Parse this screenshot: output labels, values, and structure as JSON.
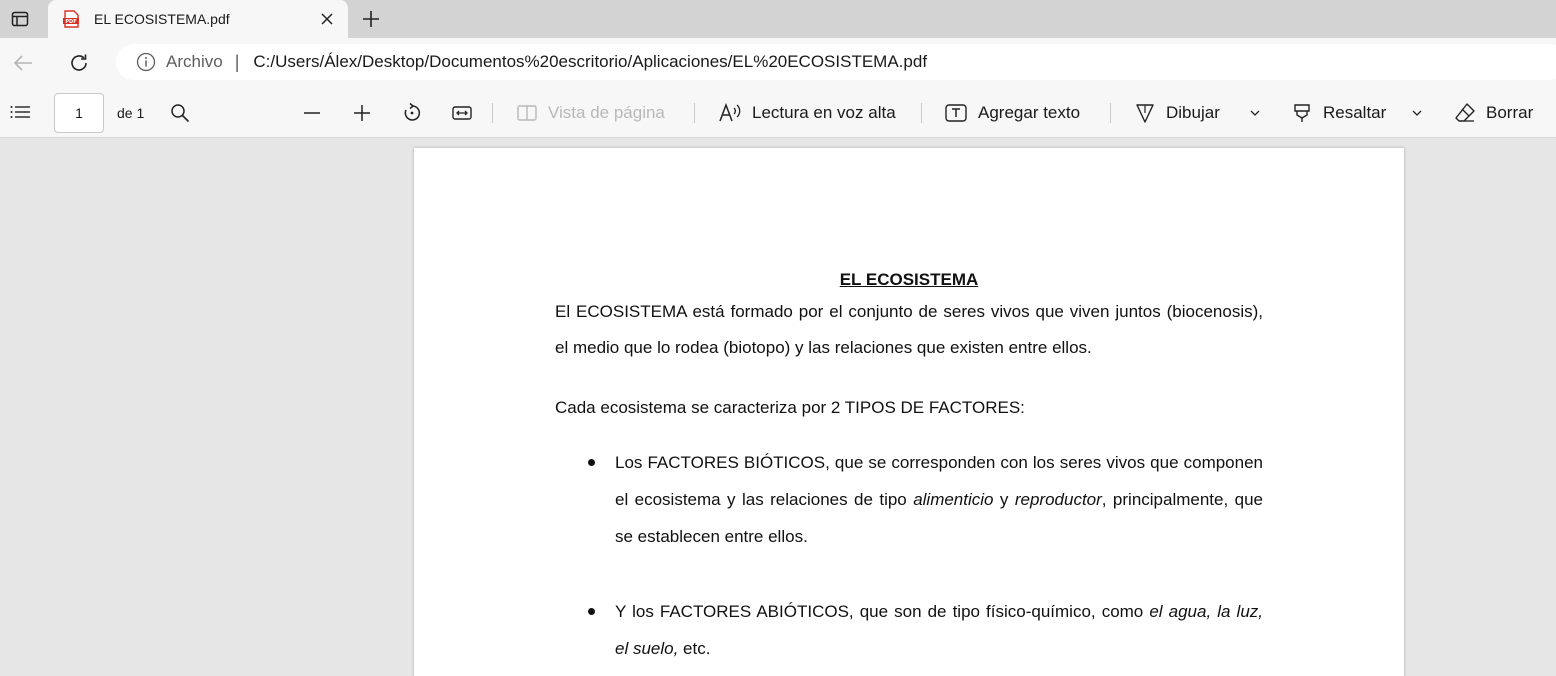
{
  "browser": {
    "tab": {
      "title": "EL ECOSISTEMA.pdf",
      "icon": "pdf-icon"
    },
    "address": {
      "scheme_label": "Archivo",
      "separator": "|",
      "url": "C:/Users/Álex/Desktop/Documentos%20escritorio/Aplicaciones/EL%20ECOSISTEMA.pdf"
    }
  },
  "pdf_toolbar": {
    "page_number": "1",
    "page_total_label": "de 1",
    "page_view_label": "Vista de página",
    "read_aloud_label": "Lectura en voz alta",
    "add_text_label": "Agregar texto",
    "draw_label": "Dibujar",
    "highlight_label": "Resaltar",
    "erase_label": "Borrar"
  },
  "document": {
    "title": "EL ECOSISTEMA",
    "para1": "El ECOSISTEMA está formado por el conjunto de seres vivos que viven juntos (biocenosis), el medio que lo rodea (biotopo) y las relaciones que existen entre ellos.",
    "para2": "Cada ecosistema se caracteriza por 2 TIPOS DE FACTORES:",
    "bullet1": {
      "part1": "Los FACTORES BIÓTICOS, que se corresponden con los seres vivos que componen el ecosistema y las relaciones de tipo ",
      "em1": "alimenticio",
      "part2": " y ",
      "em2": "reproductor",
      "part3": ", principalmente, que se establecen entre ellos."
    },
    "bullet2": {
      "part1": "Y los FACTORES ABIÓTICOS, que son de tipo físico-químico, como ",
      "em1": "el agua, la luz, el suelo,",
      "part2": " etc."
    }
  },
  "colors": {
    "tabstrip": "#d3d3d3",
    "toolbar": "#f7f7f7",
    "viewer": "#e6e6e6",
    "pdf_red": "#d93025"
  }
}
